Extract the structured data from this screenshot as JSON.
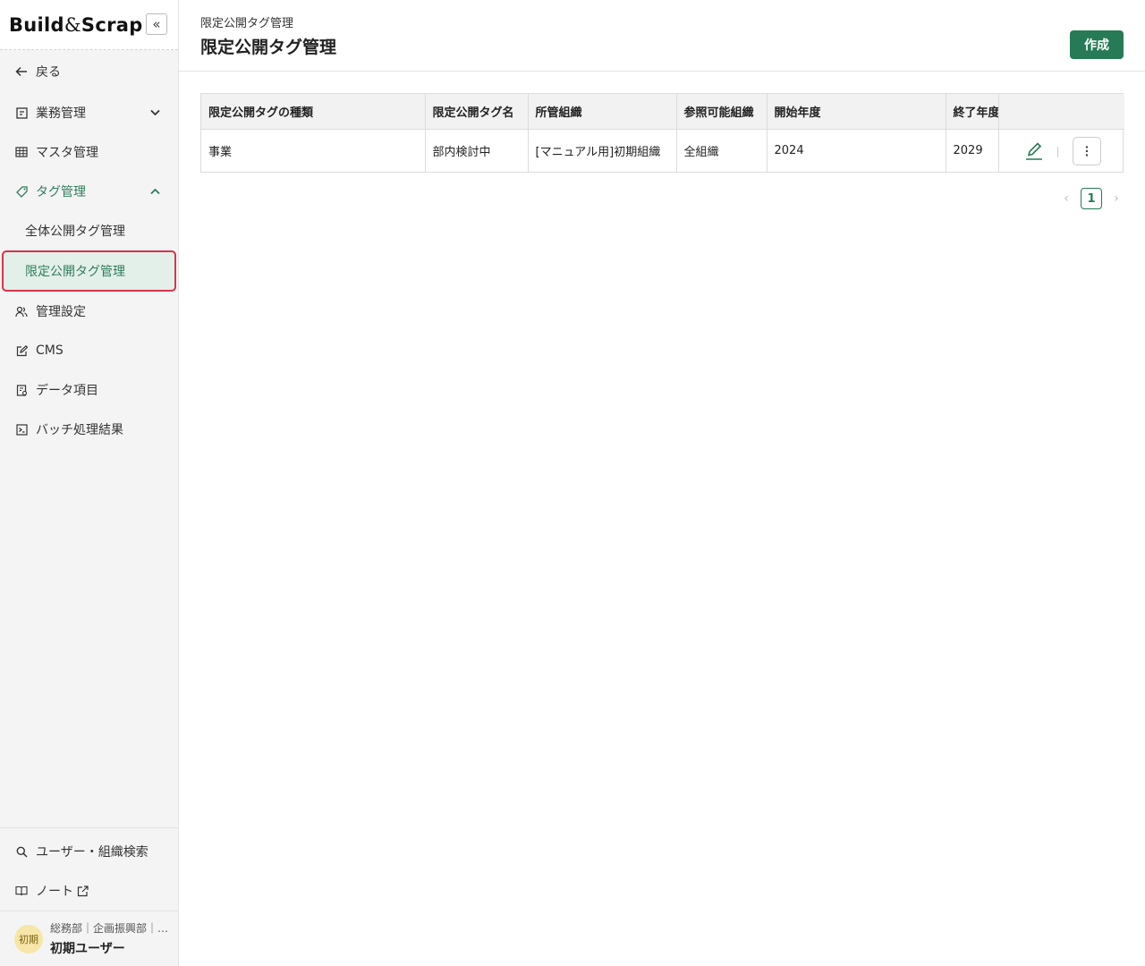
{
  "sidebar": {
    "logo": {
      "part1": "Build",
      "amp": "&",
      "part2": "Scrap"
    },
    "collapse_icon": "«",
    "back": {
      "label": "戻る",
      "icon": "arrow-left-icon"
    },
    "items": [
      {
        "label": "業務管理",
        "icon": "form-icon",
        "chevron": "⌄"
      },
      {
        "label": "マスタ管理",
        "icon": "grid-icon"
      },
      {
        "label": "タグ管理",
        "icon": "tag-icon",
        "chevron": "⌃"
      }
    ],
    "tag_sub_items": [
      {
        "label": "全体公開タグ管理"
      },
      {
        "label": "限定公開タグ管理"
      }
    ],
    "items2": [
      {
        "label": "管理設定",
        "icon": "users-icon"
      },
      {
        "label": "CMS",
        "icon": "edit-square-icon"
      },
      {
        "label": "データ項目",
        "icon": "data-list-icon"
      },
      {
        "label": "バッチ処理結果",
        "icon": "terminal-icon"
      }
    ],
    "bottom": [
      {
        "label": "ユーザー・組織検索",
        "icon": "search-icon"
      },
      {
        "label": "ノート",
        "icon": "book-icon",
        "external_icon": "external-link-icon"
      }
    ],
    "user": {
      "avatar": "初期",
      "org": "総務部｜企画振興部｜…",
      "name": "初期ユーザー"
    }
  },
  "header": {
    "breadcrumb": "限定公開タグ管理",
    "title": "限定公開タグ管理",
    "create_label": "作成"
  },
  "table": {
    "columns": [
      "限定公開タグの種類",
      "限定公開タグ名",
      "所管組織",
      "参照可能組織",
      "開始年度",
      "終了年度"
    ],
    "rows": [
      [
        "事業",
        "部内検討中",
        "[マニュアル用]初期組織",
        "全組織",
        "2024",
        "2029"
      ]
    ]
  },
  "pager": {
    "prev": "‹",
    "current": "1",
    "next": "›"
  },
  "colors": {
    "accent": "#277a56",
    "selected_bg": "#e3efe9",
    "highlight_border": "#d8334a"
  }
}
